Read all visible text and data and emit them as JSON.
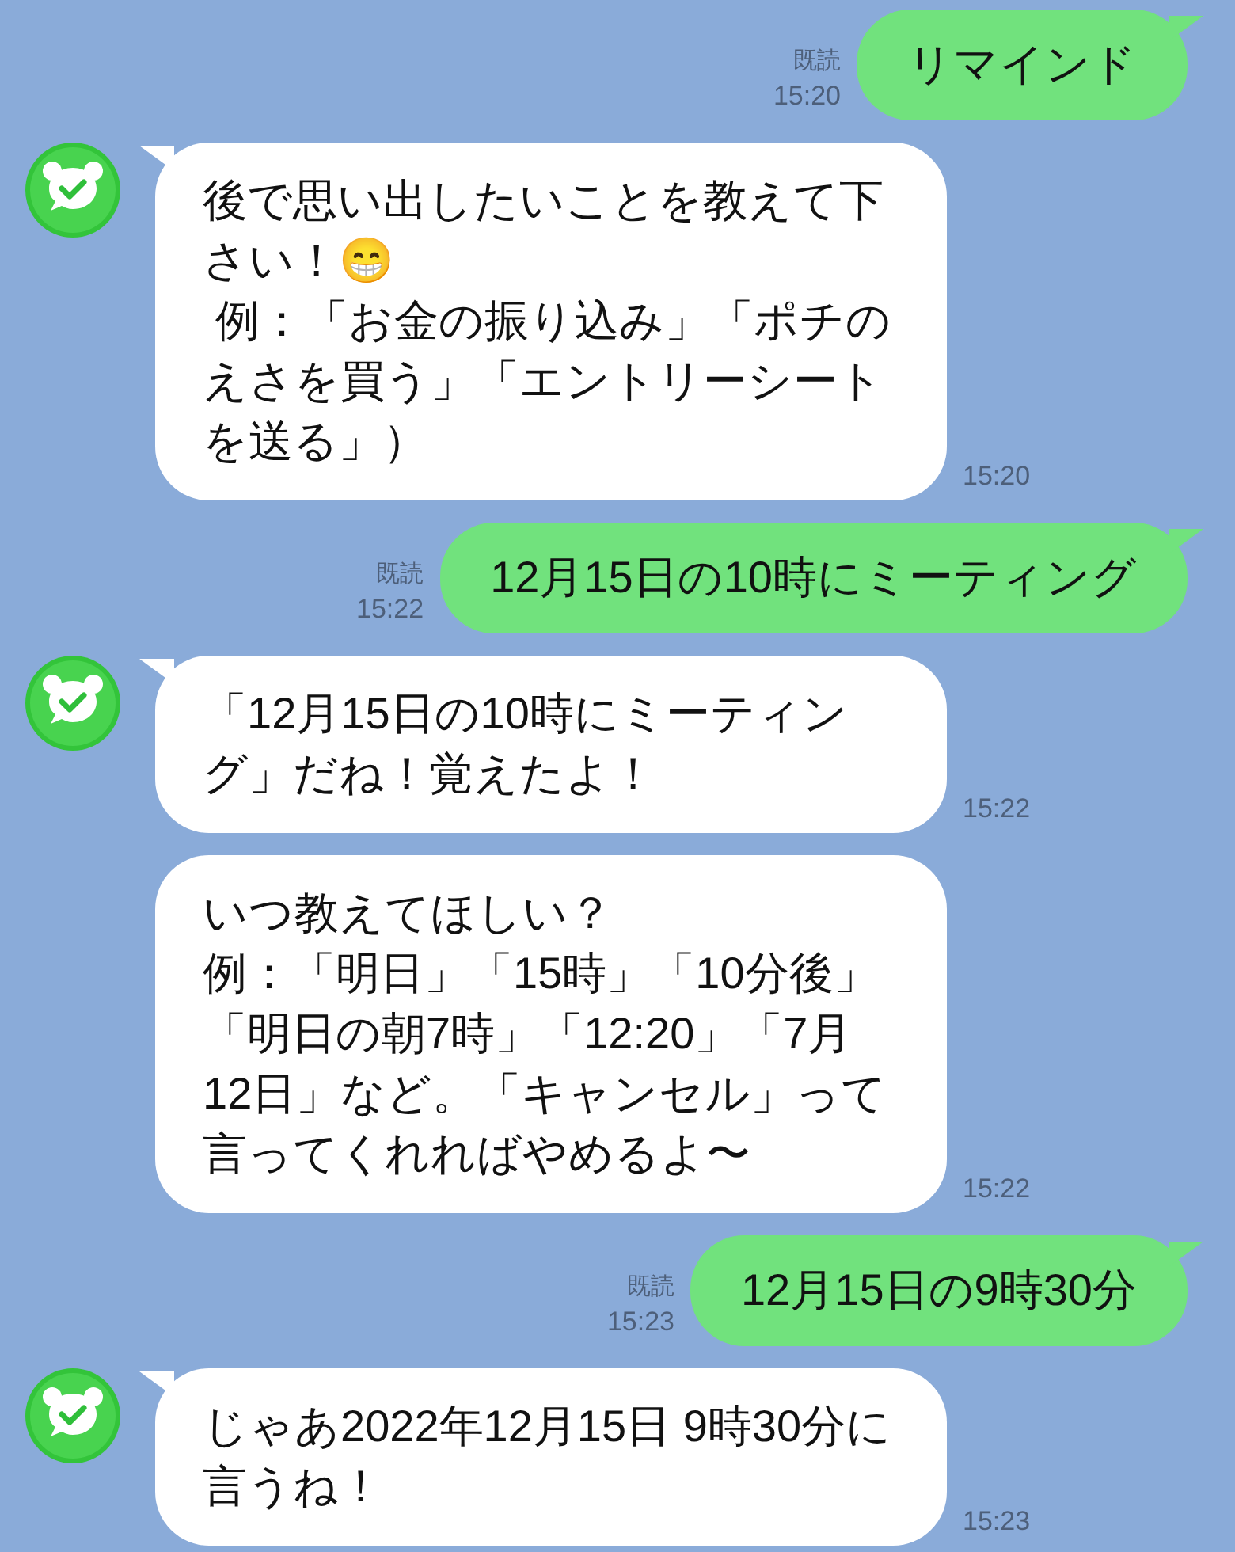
{
  "messages": [
    {
      "kind": "sent",
      "text": "リマインド",
      "read": "既読",
      "time": "15:20"
    },
    {
      "kind": "received",
      "avatar": true,
      "lines": [
        "後で思い出したいことを教えて下さい！😁",
        " 例：「お金の振り込み」「ポチのえさを買う」「エントリーシートを送る」）"
      ],
      "time": "15:20"
    },
    {
      "kind": "sent",
      "text": "12月15日の10時にミーティング",
      "read": "既読",
      "time": "15:22"
    },
    {
      "kind": "received",
      "avatar": true,
      "text": "「12月15日の10時にミーティング」だね！覚えたよ！",
      "time": "15:22"
    },
    {
      "kind": "received",
      "avatar": false,
      "lines": [
        "いつ教えてほしい？",
        "例：「明日」「15時」「10分後」「明日の朝7時」「12:20」「7月12日」など。「キャンセル」って言ってくれればやめるよ〜"
      ],
      "time": "15:22"
    },
    {
      "kind": "sent",
      "text": "12月15日の9時30分",
      "read": "既読",
      "time": "15:23"
    },
    {
      "kind": "received",
      "avatar": true,
      "text": "じゃあ2022年12月15日 9時30分に言うね！",
      "time": "15:23"
    }
  ]
}
